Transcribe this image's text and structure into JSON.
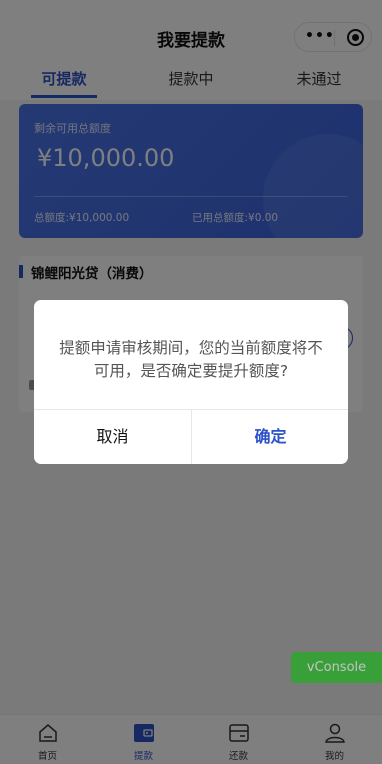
{
  "nav": {
    "title": "我要提款",
    "more_icon": "more-dots-icon",
    "close_icon": "target-close-icon"
  },
  "tabs": [
    {
      "label": "可提款",
      "active": true
    },
    {
      "label": "提款中",
      "active": false
    },
    {
      "label": "未通过",
      "active": false
    }
  ],
  "card": {
    "label": "剩余可用总额度",
    "amount": "¥10,000.00",
    "total": "总额度:¥10,000.00",
    "used": "已用总额度:¥0.00"
  },
  "product": {
    "title": "锦鲤阳光贷（消费）"
  },
  "dialog": {
    "message": "提额申请审核期间，您的当前额度将不可用，是否确定要提升额度?",
    "cancel_label": "取消",
    "confirm_label": "确定"
  },
  "vconsole": {
    "label": "vConsole"
  },
  "tabbar": [
    {
      "label": "首页",
      "icon": "home-icon",
      "active": false
    },
    {
      "label": "提款",
      "icon": "wallet-icon",
      "active": true
    },
    {
      "label": "还款",
      "icon": "card-icon",
      "active": false
    },
    {
      "label": "我的",
      "icon": "user-icon",
      "active": false
    }
  ],
  "colors": {
    "accent": "#2c52c7",
    "card_blue": "#4a73e8",
    "vconsole_green": "#04be02"
  }
}
